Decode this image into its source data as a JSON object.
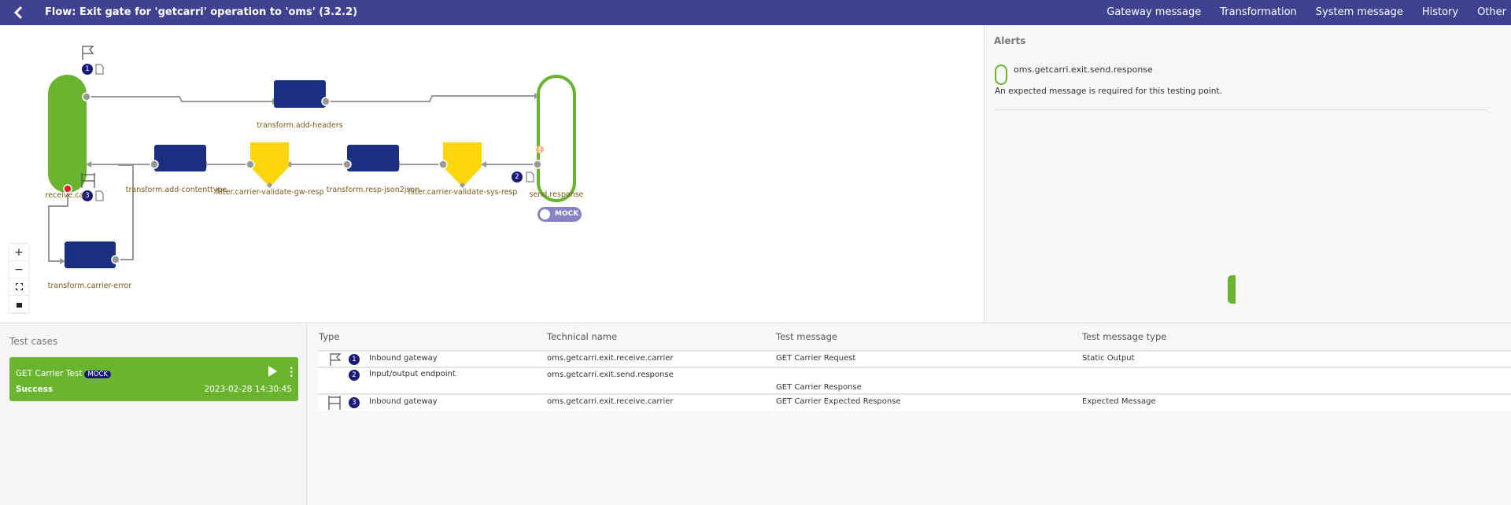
{
  "header": {
    "title": "Flow: Exit gate for 'getcarri' operation to 'oms' (3.2.2)",
    "nav": [
      "Gateway message",
      "Transformation",
      "System message",
      "History",
      "Other"
    ]
  },
  "flow": {
    "nodes": {
      "receive": "receive.carrier",
      "add_headers": "transform.add-headers",
      "send_response": "send.response",
      "add_contenttype": "transform.add-contenttype",
      "gw_resp": "filter.carrier-validate-gw-resp",
      "json2json": "transform.resp-json2json",
      "sys_resp": "filter.carrier-validate-sys-resp",
      "carrier_error": "transform.carrier-error"
    },
    "badges": [
      "1",
      "2",
      "3"
    ],
    "mock_label": "MOCK",
    "zoom_controls": {
      "plus": "+",
      "minus": "−"
    },
    "colors": {
      "gateway": "#6ab42f",
      "transform": "#1a2f80",
      "filter": "#fdd60e",
      "edge": "#999999",
      "error_port": "#e8202a"
    }
  },
  "alerts": {
    "title": "Alerts",
    "items": [
      {
        "name": "oms.getcarri.exit.send.response",
        "message": "An expected message is required for this testing point."
      }
    ]
  },
  "test_cases": {
    "title": "Test cases",
    "items": [
      {
        "name": "GET Carrier Test",
        "badge": "MOCK",
        "status": "Success",
        "date": "2023-02-28 14:30:45"
      }
    ]
  },
  "table": {
    "headers": [
      "Type",
      "Technical name",
      "Test message",
      "Test message type"
    ],
    "rows": [
      {
        "icon": "flag-icon",
        "num": "1",
        "type": "Inbound gateway",
        "technical": "oms.getcarri.exit.receive.carrier",
        "message": "GET Carrier Request",
        "message_type": "Static Output"
      },
      {
        "icon": "",
        "num": "2",
        "type": "Input/output endpoint",
        "technical": "oms.getcarri.exit.send.response",
        "message": "GET Carrier Response",
        "message_type": ""
      },
      {
        "icon": "finish-gate-icon",
        "num": "3",
        "type": "Inbound gateway",
        "technical": "oms.getcarri.exit.receive.carrier",
        "message": "GET Carrier Expected Response",
        "message_type": "Expected Message"
      }
    ]
  }
}
